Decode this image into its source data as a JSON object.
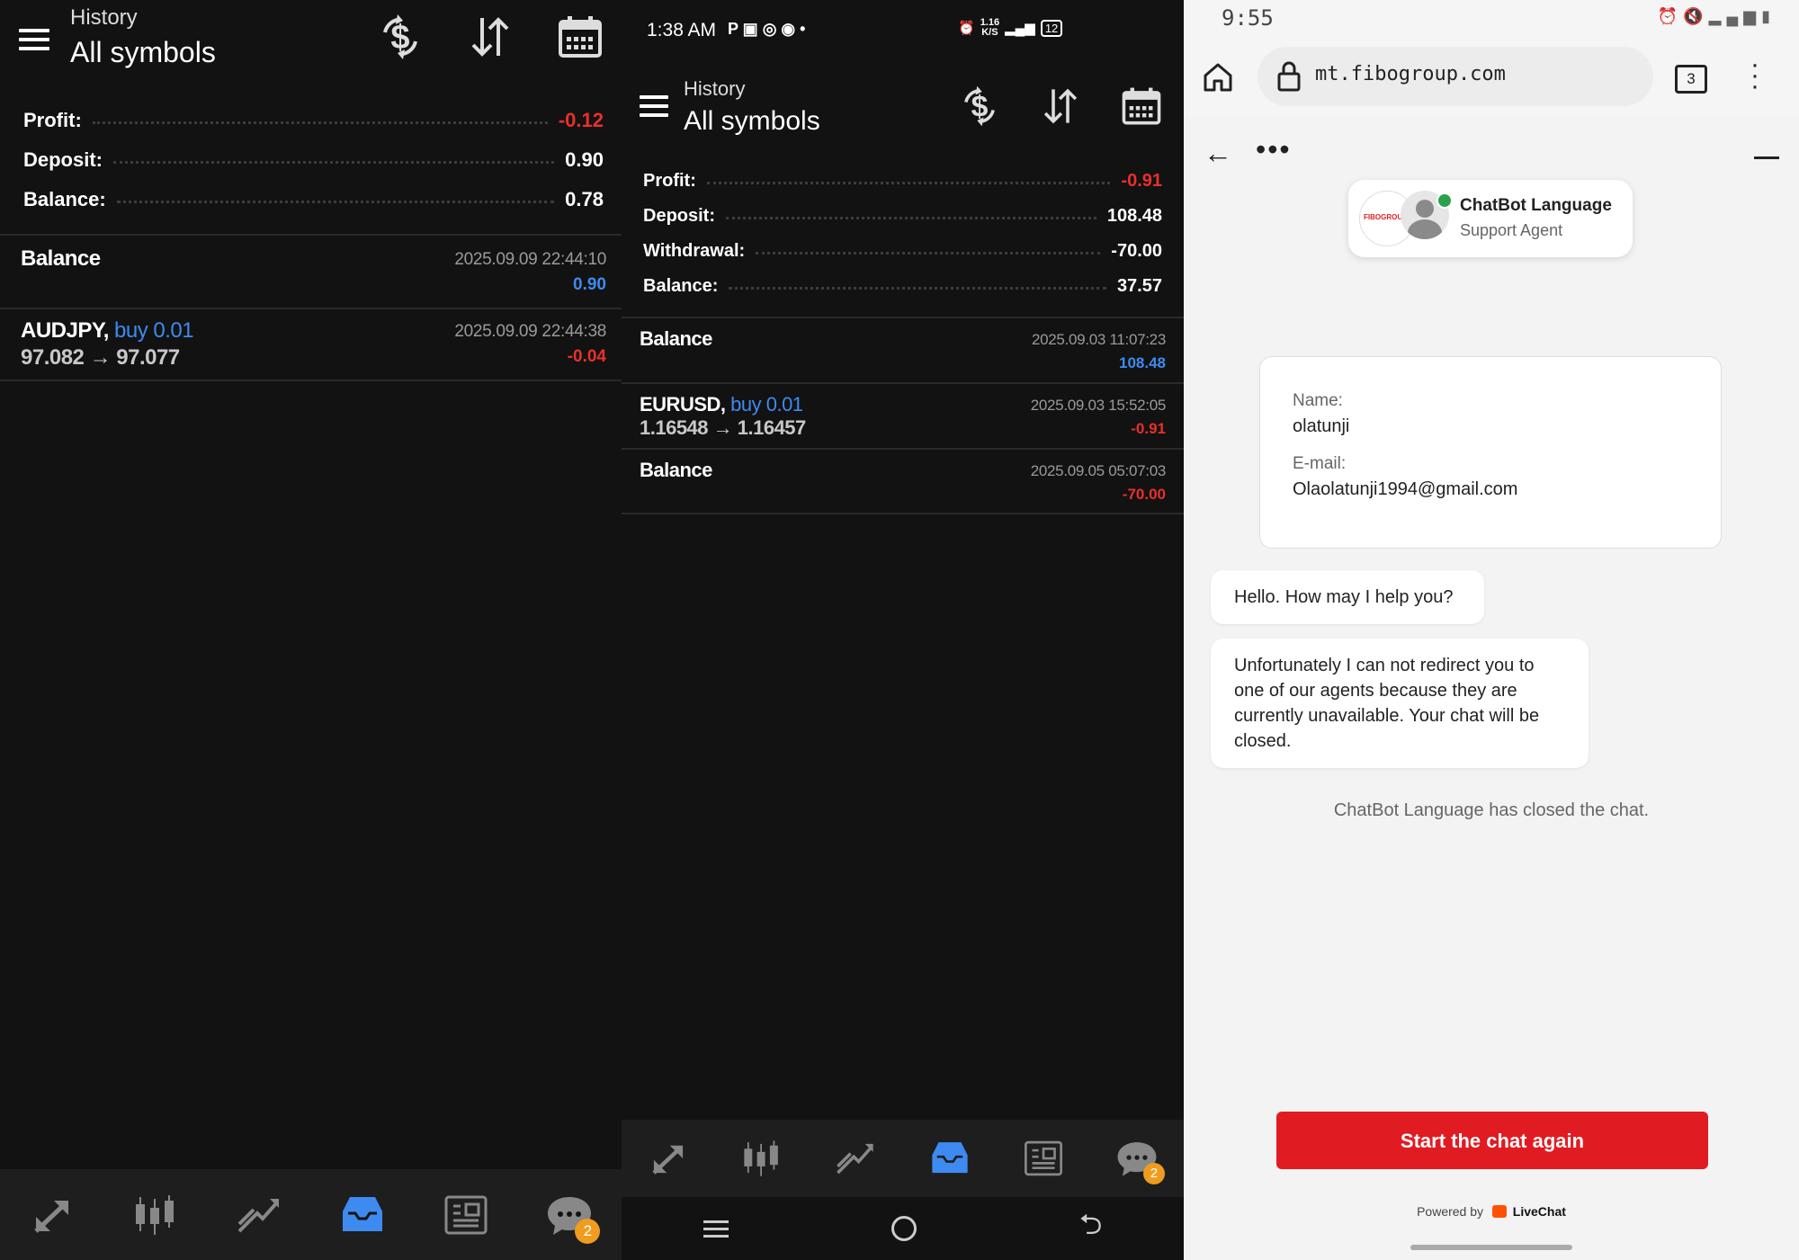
{
  "history_app": {
    "header": {
      "subtitle": "History",
      "title": "All symbols"
    },
    "colors": {
      "negative": "#e8302a",
      "positive": "#3d8bf0",
      "background": "#121212"
    },
    "toolbar_icons": [
      "dollar-refresh-icon",
      "sort-icon",
      "calendar-icon"
    ],
    "nav_icons": [
      "trade-icon",
      "candles-icon",
      "chart-icon",
      "history-inbox-icon",
      "news-icon",
      "chat-icon"
    ]
  },
  "left": {
    "summary": [
      {
        "label": "Profit:",
        "value": "-0.12",
        "negative": true
      },
      {
        "label": "Deposit:",
        "value": "0.90"
      },
      {
        "label": "Balance:",
        "value": "0.78"
      }
    ],
    "deals": [
      {
        "title": "Balance",
        "date": "2025.09.09 22:44:10",
        "amount": "0.90"
      },
      {
        "symbol": "AUDJPY,",
        "side": "buy 0.01",
        "prices": "97.082 → 97.077",
        "date": "2025.09.09 22:44:38",
        "amount": "-0.04"
      }
    ],
    "chat_badge": "2"
  },
  "middle": {
    "status_bar": {
      "time": "1:38 AM",
      "net_speed": "1.16",
      "net_unit": "K/S",
      "battery": "12"
    },
    "summary": [
      {
        "label": "Profit:",
        "value": "-0.91"
      },
      {
        "label": "Deposit:",
        "value": "108.48"
      },
      {
        "label": "Withdrawal:",
        "value": "-70.00"
      },
      {
        "label": "Balance:",
        "value": "37.57"
      }
    ],
    "deals": [
      {
        "title": "Balance",
        "date": "2025.09.03 11:07:23",
        "amount": "108.48"
      },
      {
        "symbol": "EURUSD,",
        "side": "buy 0.01",
        "prices": "1.16548 → 1.16457",
        "date": "2025.09.03 15:52:05",
        "amount": "-0.91"
      },
      {
        "title": "Balance",
        "date": "2025.09.05 05:07:03",
        "amount": "-70.00"
      }
    ],
    "chat_badge": "2"
  },
  "right": {
    "status_bar": {
      "time": "9:55"
    },
    "browser": {
      "url": "mt.fibogroup.com",
      "tab_count": "3"
    },
    "agent": {
      "name": "ChatBot Language",
      "role": "Support Agent",
      "logo_text": "FIBOGROUP"
    },
    "form": {
      "name_label": "Name:",
      "name_value": "olatunji",
      "email_label": "E-mail:",
      "email_value": "Olaolatunji1994@gmail.com"
    },
    "messages": [
      "Hello. How may I help you?",
      "Unfortunately I can not redirect you to one of our agents because they are currently unavailable. Your chat will be closed."
    ],
    "system_message": "ChatBot Language has closed the chat.",
    "start_button": "Start the chat again",
    "powered_by": "Powered by",
    "powered_brand": "LiveChat",
    "colors": {
      "button": "#e11b22",
      "online": "#2aa14a",
      "livechat": "#ff5100"
    }
  }
}
